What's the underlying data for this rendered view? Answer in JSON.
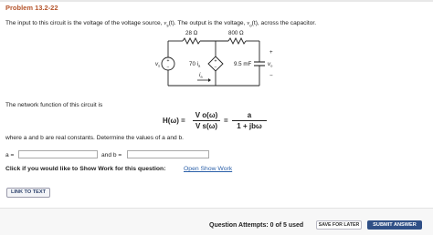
{
  "problem": {
    "title": "Problem 13.2-22",
    "intro_a": "The input to this circuit is the voltage of the voltage source, ",
    "intro_vs": "v",
    "intro_vs_sub": "s",
    "intro_b": "(t). The output is the voltage, ",
    "intro_vo": "v",
    "intro_vo_sub": "o",
    "intro_c": "(t), across the capacitor."
  },
  "circuit": {
    "r1": "28 Ω",
    "r2": "800 Ω",
    "cap": "9.5 mF",
    "dep_gain": "70 i",
    "dep_gain_sub": "a",
    "src_label": "v",
    "src_label_sub": "s",
    "current_label": "i",
    "current_label_sub": "a",
    "out_label": "v",
    "out_label_sub": "o",
    "plus": "+",
    "minus": "−"
  },
  "network_text": "The network function of this circuit is",
  "formula": {
    "lhs": "H(ω) =",
    "num1": "V o(ω)",
    "den1": "V s(ω)",
    "eq2": "=",
    "num2": "a",
    "den2": "1 + jbω"
  },
  "where_text": "where a and b are real constants. Determine the values of a and b.",
  "answers": {
    "a_label": "a =",
    "b_label": "and b =",
    "a_value": "",
    "b_value": ""
  },
  "showwork": {
    "prompt": "Click if you would like to Show Work for this question:",
    "link": "Open Show Work"
  },
  "link_to_text": "LINK TO TEXT",
  "footer": {
    "attempts": "Question Attempts: 0 of 5 used",
    "save": "SAVE FOR LATER",
    "submit": "SUBMIT ANSWER"
  }
}
